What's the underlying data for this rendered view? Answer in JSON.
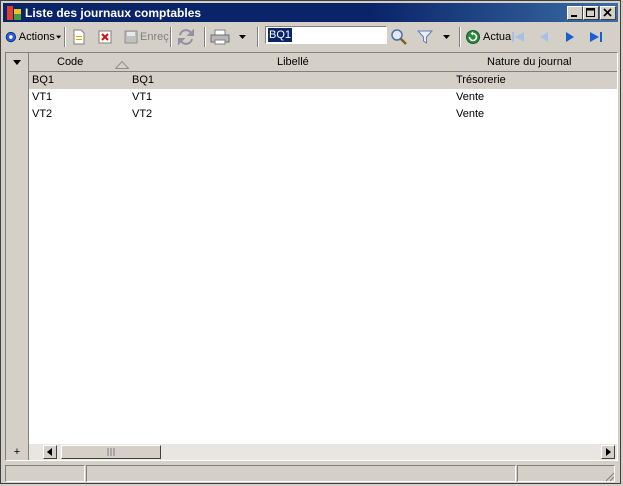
{
  "window": {
    "title": "Liste des journaux comptables"
  },
  "toolbar": {
    "actions_label": "Actions",
    "save_label": "Enreç",
    "search_value": "BQ1",
    "refresh_label": "Actua"
  },
  "grid": {
    "columns": [
      "Code",
      "Libellé",
      "Nature du journal"
    ],
    "rows": [
      {
        "code": "BQ1",
        "libelle": "BQ1",
        "nature": "Trésorerie"
      },
      {
        "code": "VT1",
        "libelle": "VT1",
        "nature": "Vente"
      },
      {
        "code": "VT2",
        "libelle": "VT2",
        "nature": "Vente"
      }
    ],
    "add_label": "+"
  },
  "colors": {
    "title_bar": "#0a246a",
    "selected_row": "#d4d0c8",
    "nav_blue": "#1a5fd0"
  }
}
